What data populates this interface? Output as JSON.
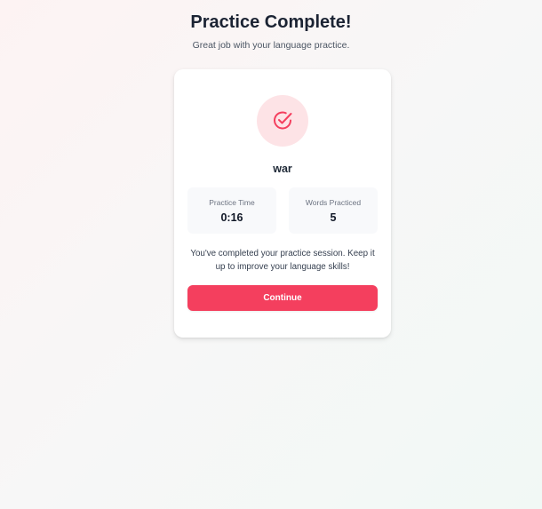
{
  "header": {
    "title": "Practice Complete!",
    "subtitle": "Great job with your language practice."
  },
  "result": {
    "icon": "check-circle-icon",
    "word": "war",
    "stats": {
      "time_label": "Practice Time",
      "time_value": "0:16",
      "words_label": "Words Practiced",
      "words_value": "5"
    },
    "message": "You've completed your practice session. Keep it up to improve your language skills!",
    "continue_label": "Continue"
  },
  "colors": {
    "accent": "#f43f5e",
    "icon_bg": "#fde3e6",
    "icon_stroke": "#f43f5e"
  }
}
